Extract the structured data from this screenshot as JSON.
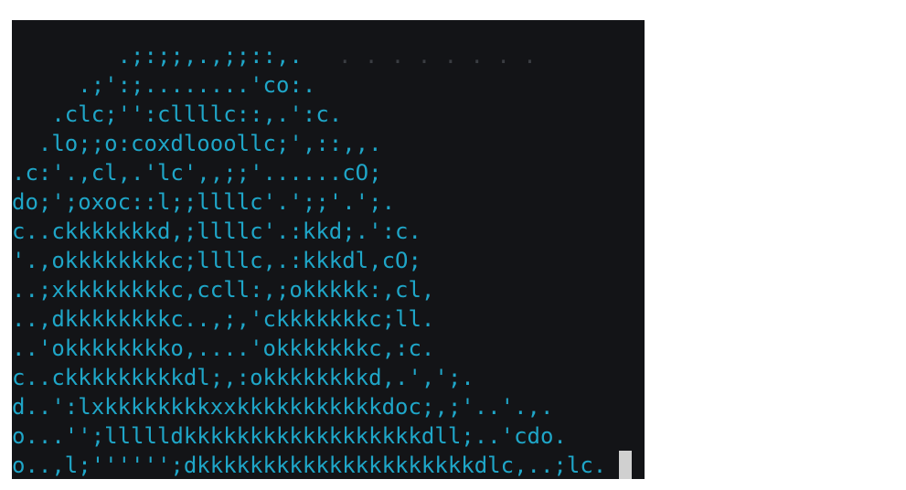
{
  "terminal": {
    "lines": [
      "        .;:;;,.,;;::,.",
      "     .;':;........'co:.",
      "   .clc;'':cllllc::,.':c.",
      "  .lo;;o:coxdlooollc;',::,,.",
      ".c:'.,cl,.'lc',,;;'......cO;",
      "do;';oxoc::l;;llllc'.';;'.';.",
      "c..ckkkkkkkd,;llllc'.:kkd;.':c.",
      "'.,okkkkkkkkc;llllc,.:kkkdl,cO;",
      "..;xkkkkkkkkc,ccll:,;okkkkk:,cl,",
      "..,dkkkkkkkkc..,;,'ckkkkkkkc;ll.",
      "..'okkkkkkkko,....'okkkkkkkc,:c.",
      "c..ckkkkkkkkkdl;,:okkkkkkkkd,.',';.",
      "d..':lxkkkkkkkkxxkkkkkkkkkkkdoc;,;'..'.,.",
      "o...'';llllldkkkkkkkkkkkkkkkkkkdll;..'cdo.",
      "o..,l;'''''';dkkkkkkkkkkkkkkkkkkkkkdlc,..;lc."
    ],
    "faint_trail": ". . . . . . . .",
    "text_color": "#1fa6c8",
    "background_color": "#131417"
  }
}
